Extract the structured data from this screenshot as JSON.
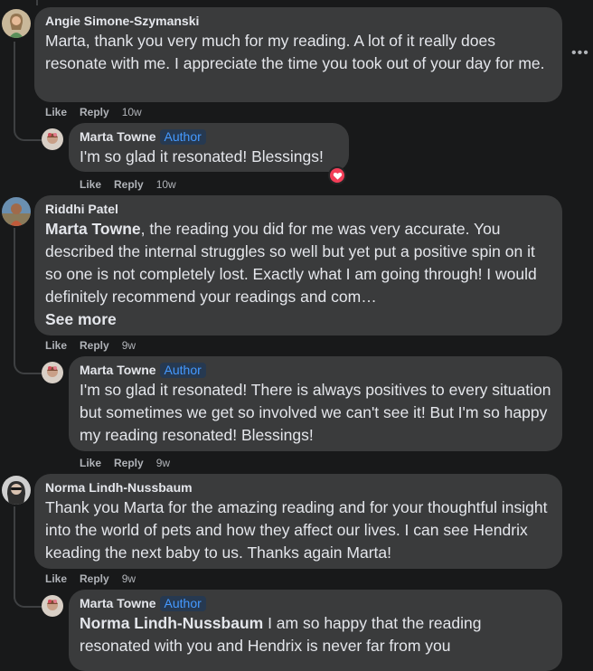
{
  "comments": [
    {
      "author": "Angie Simone-Szymanski",
      "text": "Marta, thank you very much for my reading. A lot of it really does resonate with me. I appreciate the time you took out of your day for me.",
      "actions": {
        "like": "Like",
        "reply": "Reply",
        "time": "10w"
      },
      "reply": {
        "author": "Marta Towne",
        "badge": "Author",
        "text": "I'm so glad it resonated! Blessings!",
        "actions": {
          "like": "Like",
          "reply": "Reply",
          "time": "10w"
        },
        "reaction": "heart-reaction"
      }
    },
    {
      "author": "Riddhi Patel",
      "mention": "Marta Towne",
      "text": ", the reading you did for me was very accurate. You described the internal struggles so well but yet put a positive spin on it so one is not completely lost. Exactly what I am going through! I would definitely recommend your readings and com…",
      "see_more": "See more",
      "actions": {
        "like": "Like",
        "reply": "Reply",
        "time": "9w"
      },
      "reply": {
        "author": "Marta Towne",
        "badge": "Author",
        "text": "I'm so glad it resonated! There is always positives to every situation but sometimes we get so involved we can't see it! But I'm so happy my reading resonated! Blessings!",
        "actions": {
          "like": "Like",
          "reply": "Reply",
          "time": "9w"
        }
      }
    },
    {
      "author": "Norma Lindh-Nussbaum",
      "text": "Thank you Marta for the amazing reading and for your thoughtful insight into the world of pets and how they affect our lives. I can see Hendrix keading the next baby to us. Thanks again Marta!",
      "actions": {
        "like": "Like",
        "reply": "Reply",
        "time": "9w"
      },
      "reply": {
        "author": "Marta Towne",
        "badge": "Author",
        "mention": "Norma Lindh-Nussbaum",
        "text": " I am so happy that the reading resonated with you and Hendrix is never far from you"
      }
    }
  ],
  "more_options_icon": "more-horizontal-icon",
  "colors": {
    "background": "#18191a",
    "bubble": "#3a3b3c",
    "author_badge_bg": "#263951",
    "author_badge_text": "#4599ff",
    "heart": "#f33e58"
  }
}
